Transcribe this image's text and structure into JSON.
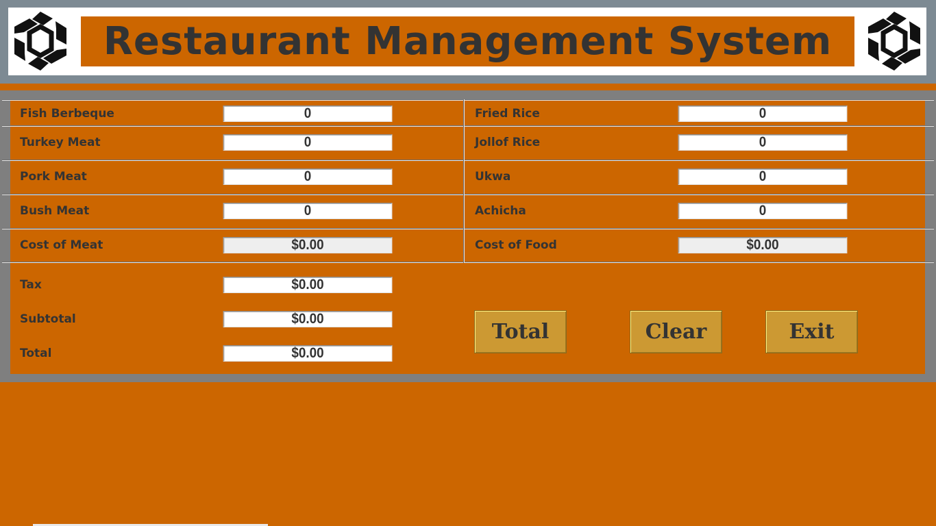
{
  "header": {
    "title": "Restaurant Management System",
    "logo_icon": "hexagon-swirl-logo"
  },
  "meat_items": [
    {
      "label": "Fish Berbeque",
      "value": "0"
    },
    {
      "label": "Turkey Meat",
      "value": "0"
    },
    {
      "label": "Pork Meat",
      "value": "0"
    },
    {
      "label": "Bush Meat",
      "value": "0"
    }
  ],
  "food_items": [
    {
      "label": "Fried Rice",
      "value": "0"
    },
    {
      "label": "Jollof Rice",
      "value": "0"
    },
    {
      "label": "Ukwa",
      "value": "0"
    },
    {
      "label": "Achicha",
      "value": "0"
    }
  ],
  "cost_of_meat": {
    "label": "Cost of Meat",
    "value": "$0.00"
  },
  "cost_of_food": {
    "label": "Cost of Food",
    "value": "$0.00"
  },
  "summary": {
    "tax": {
      "label": "Tax",
      "value": "$0.00"
    },
    "subtotal": {
      "label": "Subtotal",
      "value": "$0.00"
    },
    "total": {
      "label": "Total",
      "value": "$0.00"
    }
  },
  "buttons": {
    "total": "Total",
    "clear": "Clear",
    "exit": "Exit"
  },
  "colors": {
    "background": "#cc6600",
    "frame": "#7d8a93",
    "button": "#cc9933",
    "text": "#333333"
  }
}
